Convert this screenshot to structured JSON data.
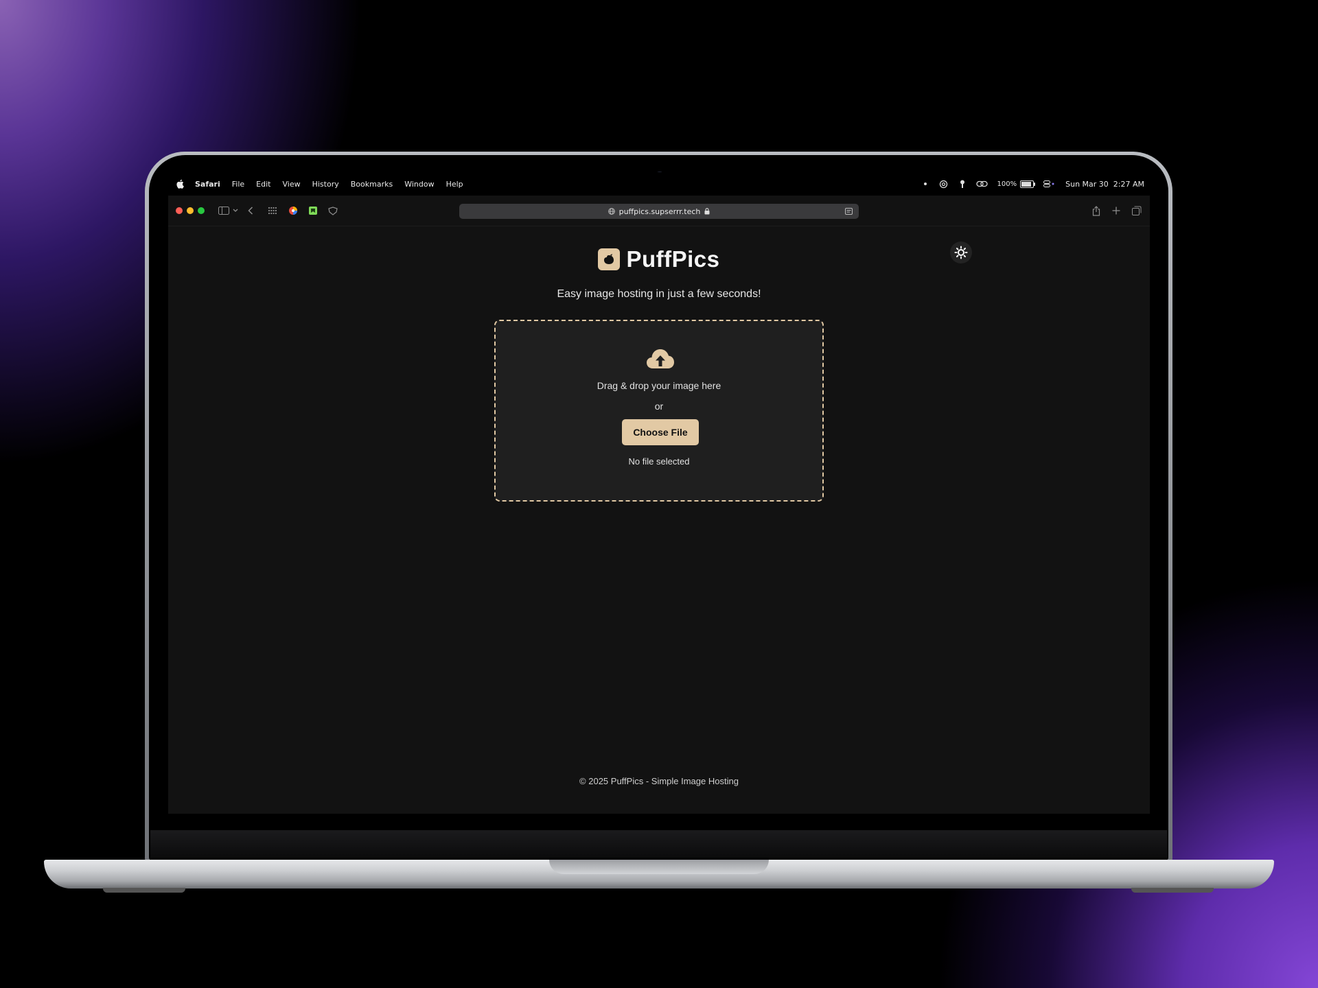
{
  "menubar": {
    "app": "Safari",
    "items": [
      "File",
      "Edit",
      "View",
      "History",
      "Bookmarks",
      "Window",
      "Help"
    ],
    "battery": "100%",
    "datetime": "Sun Mar 30  2:27 AM"
  },
  "browser": {
    "url": "puffpics.supserrr.tech"
  },
  "page": {
    "brand": "PuffPics",
    "tagline": "Easy image hosting in just a few seconds!",
    "dropzone": {
      "prompt": "Drag & drop your image here",
      "or": "or",
      "button": "Choose File",
      "status": "No file selected"
    },
    "footer": "© 2025 PuffPics - Simple Image Hosting"
  },
  "colors": {
    "accent": "#e2c9a4",
    "background": "#121212",
    "dropzone_bg": "#1f1f1f"
  }
}
